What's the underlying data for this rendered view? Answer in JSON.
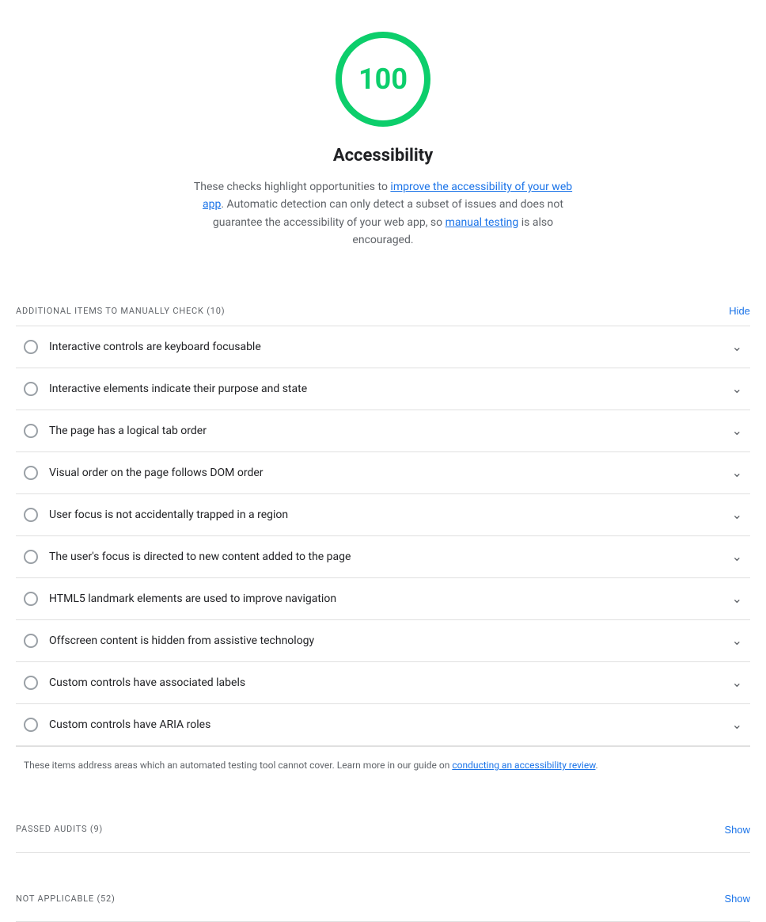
{
  "score": {
    "value": "100",
    "color": "#0cce6b"
  },
  "title": "Accessibility",
  "description": {
    "part1": "These checks highlight opportunities to ",
    "link1_text": "improve the accessibility of your web app",
    "link1_href": "#",
    "part2": ". Automatic detection can only detect a subset of issues and does not guarantee the accessibility of your web app, so ",
    "link2_text": "manual testing",
    "link2_href": "#",
    "part3": " is also encouraged."
  },
  "manual_checks": {
    "label": "ADDITIONAL ITEMS TO MANUALLY CHECK",
    "count": "(10)",
    "hide_button": "Hide",
    "items": [
      {
        "id": "item-0",
        "text": "Interactive controls are keyboard focusable"
      },
      {
        "id": "item-1",
        "text": "Interactive elements indicate their purpose and state"
      },
      {
        "id": "item-2",
        "text": "The page has a logical tab order"
      },
      {
        "id": "item-3",
        "text": "Visual order on the page follows DOM order"
      },
      {
        "id": "item-4",
        "text": "User focus is not accidentally trapped in a region"
      },
      {
        "id": "item-5",
        "text": "The user's focus is directed to new content added to the page"
      },
      {
        "id": "item-6",
        "text": "HTML5 landmark elements are used to improve navigation"
      },
      {
        "id": "item-7",
        "text": "Offscreen content is hidden from assistive technology"
      },
      {
        "id": "item-8",
        "text": "Custom controls have associated labels"
      },
      {
        "id": "item-9",
        "text": "Custom controls have ARIA roles"
      }
    ],
    "footer_note_part1": "These items address areas which an automated testing tool cannot cover. Learn more in our guide on ",
    "footer_note_link": "conducting an accessibility review",
    "footer_note_part2": "."
  },
  "passed_audits": {
    "label": "PASSED AUDITS",
    "count": "(9)",
    "show_button": "Show"
  },
  "not_applicable": {
    "label": "NOT APPLICABLE",
    "count": "(52)",
    "show_button": "Show"
  }
}
